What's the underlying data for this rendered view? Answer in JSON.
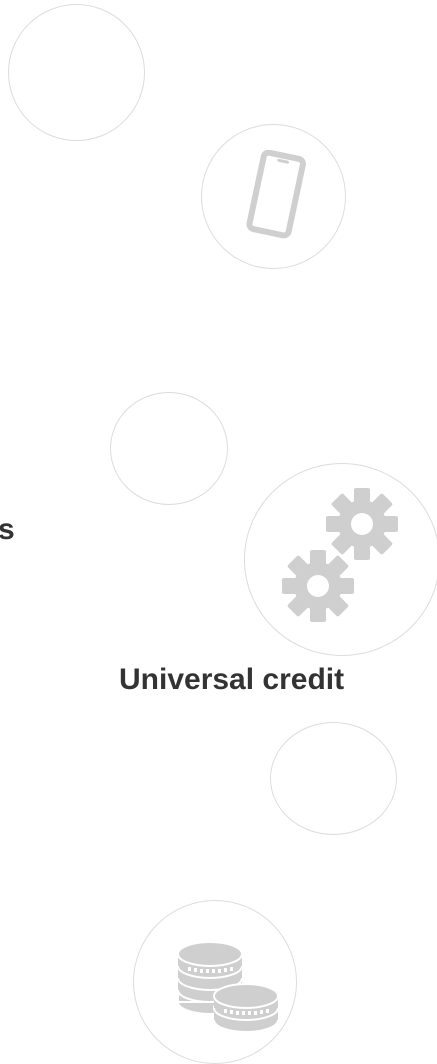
{
  "labels": {
    "partial_label": "s",
    "universal_credit": "Universal credit"
  },
  "icons": {
    "phone": "mobile-phone-icon",
    "gears": "gears-icon",
    "coins": "coins-icon"
  },
  "colors": {
    "background": "#ffffff",
    "circle_border": "#dcdcdc",
    "icon_fill": "#cfcfcf",
    "text": "#333333"
  }
}
